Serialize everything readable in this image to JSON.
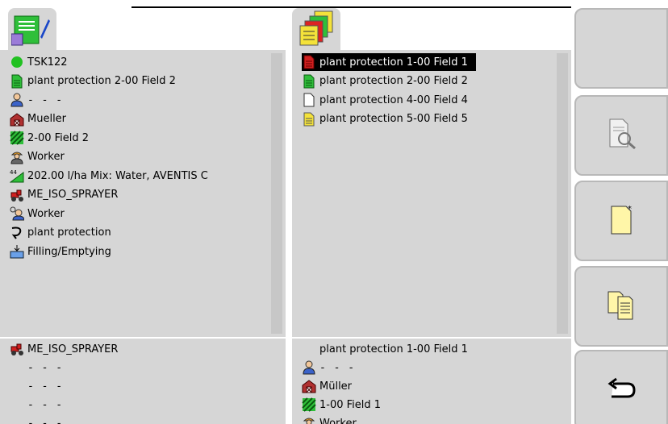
{
  "task_panel": {
    "rows": [
      {
        "icon": "green-dot-icon",
        "text": "TSK122"
      },
      {
        "icon": "document-green-icon",
        "text": "plant protection 2-00 Field 2"
      },
      {
        "icon": "customer-person-icon",
        "text": "- - -"
      },
      {
        "icon": "farm-barn-icon",
        "text": "Mueller"
      },
      {
        "icon": "field-icon",
        "text": "2-00 Field 2"
      },
      {
        "icon": "worker-icon",
        "text": "Worker"
      },
      {
        "icon": "application-rate-icon",
        "text": "202.00 l/ha Mix: Water, AVENTIS C"
      },
      {
        "icon": "tractor-icon",
        "text": "ME_ISO_SPRAYER"
      },
      {
        "icon": "worker-assigned-icon",
        "text": "Worker"
      },
      {
        "icon": "operation-icon",
        "text": "plant protection"
      },
      {
        "icon": "filling-emptying-icon",
        "text": "Filling/Emptying"
      }
    ]
  },
  "task_list": {
    "items": [
      {
        "icon": "document-red-icon",
        "text": "plant protection 1-00 Field 1",
        "selected": true
      },
      {
        "icon": "document-green-icon",
        "text": "plant protection 2-00 Field 2",
        "selected": false
      },
      {
        "icon": "document-white-icon",
        "text": "plant protection 4-00 Field 4",
        "selected": false
      },
      {
        "icon": "document-yellow-icon",
        "text": "plant protection 5-00 Field 5",
        "selected": false
      }
    ]
  },
  "bottom_left": {
    "rows": [
      {
        "icon": "tractor-icon",
        "text": "ME_ISO_SPRAYER"
      },
      {
        "icon": "",
        "text": "- - -"
      },
      {
        "icon": "",
        "text": "- - -"
      },
      {
        "icon": "",
        "text": "- - -"
      },
      {
        "icon": "",
        "text": "- - -"
      }
    ]
  },
  "bottom_right": {
    "rows": [
      {
        "icon": "",
        "text": "plant protection 1-00 Field 1"
      },
      {
        "icon": "customer-person-icon",
        "text": "- - -"
      },
      {
        "icon": "farm-barn-icon",
        "text": "Müller"
      },
      {
        "icon": "field-icon",
        "text": "1-00 Field 1"
      },
      {
        "icon": "worker-icon",
        "text": "Worker"
      }
    ]
  },
  "softkeys": [
    {
      "name": "softkey-empty",
      "icon": ""
    },
    {
      "name": "softkey-view-details",
      "icon": "document-magnifier-icon"
    },
    {
      "name": "softkey-new-task",
      "icon": "new-document-icon"
    },
    {
      "name": "softkey-copy-task",
      "icon": "copy-documents-icon"
    },
    {
      "name": "softkey-back",
      "icon": "return-arrow-icon"
    }
  ],
  "colors": {
    "panel": "#d6d6d6",
    "selection": "#000000",
    "status_green": "#22c122"
  }
}
